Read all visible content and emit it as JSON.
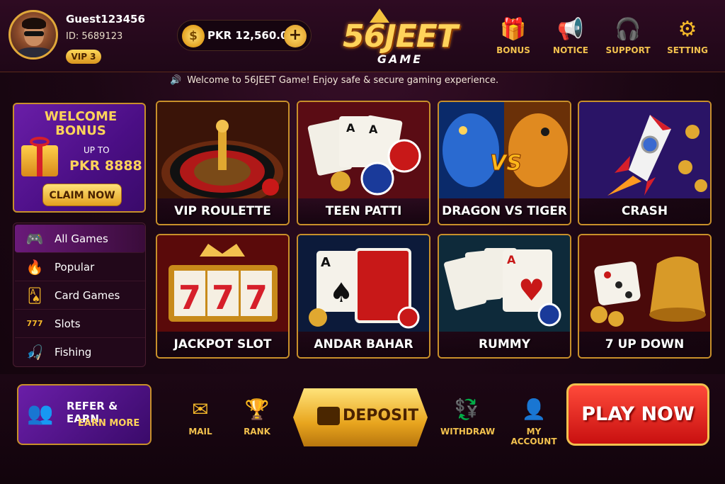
{
  "user": {
    "name": "Guest123456",
    "id": "ID: 5689123",
    "vip": "VIP 3"
  },
  "wallet": {
    "balance": "PKR 12,560.00",
    "coin_symbol": "$"
  },
  "logo": {
    "main": "56JEET",
    "sub": "GAME"
  },
  "nav": [
    {
      "label": "BONUS",
      "icon": "gift-icon",
      "glyph": "🎁"
    },
    {
      "label": "NOTICE",
      "icon": "megaphone-icon",
      "glyph": "📢"
    },
    {
      "label": "SUPPORT",
      "icon": "headset-icon",
      "glyph": "🎧"
    },
    {
      "label": "SETTING",
      "icon": "gear-icon",
      "glyph": "⚙"
    }
  ],
  "ticker": {
    "text": "Welcome to 56JEET Game! Enjoy safe & secure gaming experience."
  },
  "bonus": {
    "title_line1": "WELCOME",
    "title_line2": "BONUS",
    "upto": "UP TO",
    "amount": "PKR 8888",
    "claim": "CLAIM NOW"
  },
  "categories": [
    {
      "label": "All Games",
      "icon": "gamepad-icon",
      "glyph": "🎮",
      "active": true
    },
    {
      "label": "Popular",
      "icon": "fire-icon",
      "glyph": "🔥"
    },
    {
      "label": "Card Games",
      "icon": "cards-icon",
      "glyph": "🂡"
    },
    {
      "label": "Slots",
      "icon": "slot-777-icon",
      "glyph": "777"
    },
    {
      "label": "Fishing",
      "icon": "fishing-icon",
      "glyph": "🎣"
    }
  ],
  "games": [
    {
      "name": "VIP ROULETTE"
    },
    {
      "name": "TEEN PATTI"
    },
    {
      "name": "DRAGON VS TIGER"
    },
    {
      "name": "CRASH"
    },
    {
      "name": "JACKPOT SLOT"
    },
    {
      "name": "ANDAR BAHAR"
    },
    {
      "name": "RUMMY"
    },
    {
      "name": "7 UP DOWN"
    }
  ],
  "bottom": {
    "refer_title": "REFER & EARN",
    "refer_more": "EARN MORE",
    "mail": "MAIL",
    "rank": "RANK",
    "deposit": "DEPOSIT",
    "withdraw": "WITHDRAW",
    "my_account": "MY ACCOUNT",
    "play_now": "PLAY NOW"
  },
  "colors": {
    "accent_gold": "#f5b92a",
    "play_red": "#e0221a",
    "purple": "#5a1696"
  }
}
